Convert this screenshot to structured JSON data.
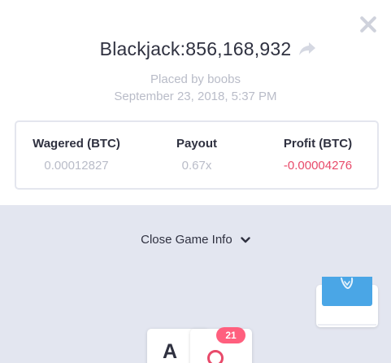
{
  "bet": {
    "title": "Blackjack:856,168,932",
    "placed_by": "Placed by boobs",
    "date": "September 23, 2018, 5:37 PM"
  },
  "stats": {
    "wagered_label": "Wagered (BTC)",
    "wagered_value": "0.00012827",
    "payout_label": "Payout",
    "payout_value": "0.67x",
    "profit_label": "Profit (BTC)",
    "profit_value": "-0.00004276"
  },
  "game_info": {
    "toggle_label": "Close Game Info"
  },
  "hand": {
    "card1_rank": "A",
    "score_badge": "21"
  },
  "icons": [
    "close-icon",
    "share-icon",
    "chevron-down-icon"
  ],
  "colors": {
    "negative": "#e84a6a",
    "badge": "#ff5f7e",
    "deck_back": "#4aa6e6",
    "muted": "#b9bcc8"
  }
}
